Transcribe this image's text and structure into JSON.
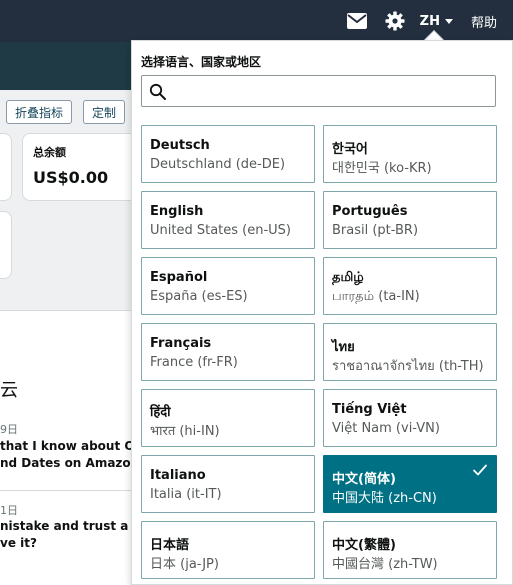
{
  "header": {
    "lang_code": "ZH",
    "help_label": "帮助",
    "icons": [
      "mail-icon",
      "gear-icon"
    ]
  },
  "background": {
    "buttons": [
      "折叠指标",
      "定制"
    ],
    "balance_card": {
      "label": "总余额",
      "value": "US$0.00"
    },
    "news": {
      "heading": "云",
      "items": [
        {
          "date": "9日",
          "lines": [
            "that I know about OT",
            "nd Dates on Amazon"
          ]
        },
        {
          "date": "1日",
          "lines": [
            "nistake and trust a buy",
            "ve it?"
          ]
        }
      ]
    }
  },
  "language_menu": {
    "title": "选择语言、国家或地区",
    "search": {
      "value": "",
      "placeholder": ""
    },
    "languages": [
      {
        "native": "Deutsch",
        "region": "Deutschland (de-DE)",
        "selected": false
      },
      {
        "native": "한국어",
        "region": "대한민국 (ko-KR)",
        "selected": false
      },
      {
        "native": "English",
        "region": "United States (en-US)",
        "selected": false
      },
      {
        "native": "Português",
        "region": "Brasil (pt-BR)",
        "selected": false
      },
      {
        "native": "Español",
        "region": "España (es-ES)",
        "selected": false
      },
      {
        "native": "தமிழ்",
        "region": "பாரதம் (ta-IN)",
        "selected": false
      },
      {
        "native": "Français",
        "region": "France (fr-FR)",
        "selected": false
      },
      {
        "native": "ไทย",
        "region": "ราชอาณาจักรไทย (th-TH)",
        "selected": false
      },
      {
        "native": "हिंदी",
        "region": "भारत (hi-IN)",
        "selected": false
      },
      {
        "native": "Tiếng Việt",
        "region": "Việt Nam (vi-VN)",
        "selected": false
      },
      {
        "native": "Italiano",
        "region": "Italia (it-IT)",
        "selected": false
      },
      {
        "native": "中文(简体)",
        "region": "中国大陆 (zh-CN)",
        "selected": true
      },
      {
        "native": "日本語",
        "region": "日本 (ja-JP)",
        "selected": false
      },
      {
        "native": "中文(繁體)",
        "region": "中國台灣 (zh-TW)",
        "selected": false
      }
    ]
  },
  "colors": {
    "topbar": "#232f3e",
    "selected": "#007185",
    "tile_border": "#7fa6ad"
  }
}
